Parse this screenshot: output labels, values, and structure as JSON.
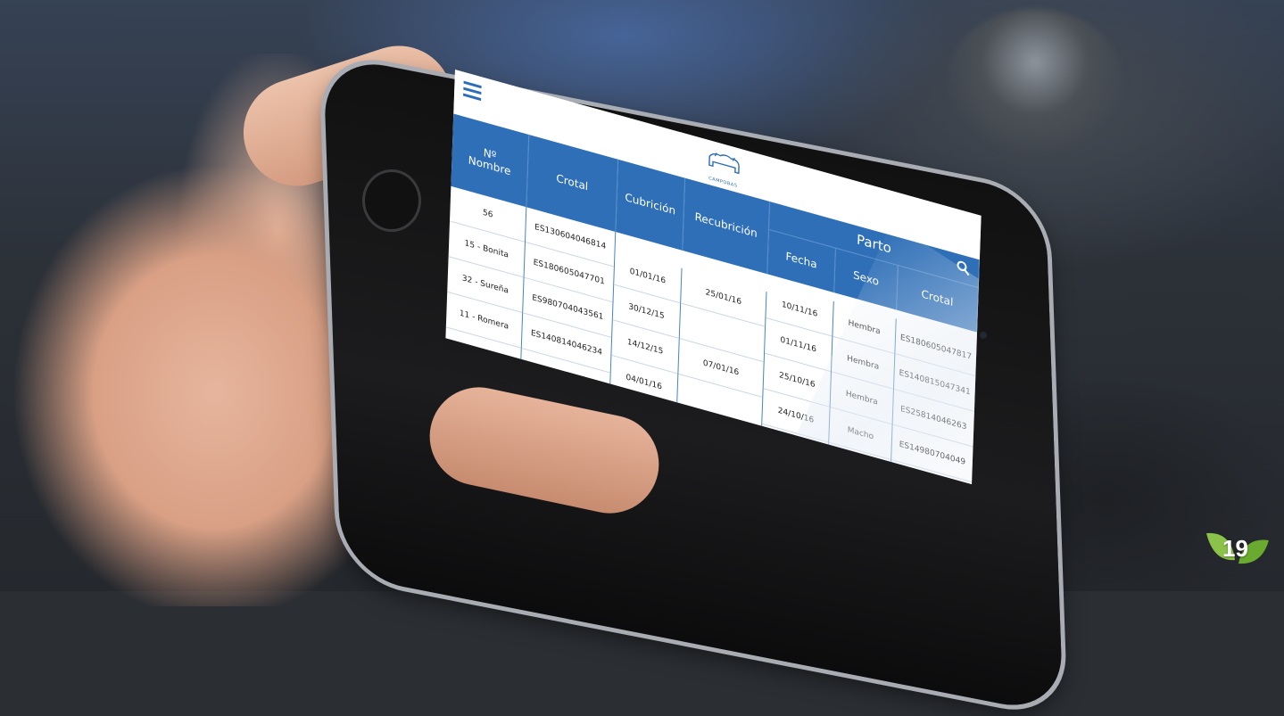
{
  "brand": {
    "logo_text": "CAMPOBAS"
  },
  "table": {
    "headers": {
      "numero_nombre_line1": "Nº",
      "numero_nombre_line2": "Nombre",
      "crotal": "Crotal",
      "cubricion": "Cubrición",
      "recubricion": "Recubrición",
      "parto": "Parto",
      "fecha": "Fecha",
      "sexo": "Sexo",
      "crotal_parto": "Crotal"
    },
    "col_nombre": [
      "56",
      "15 - Bonita",
      "32 - Sureña",
      "11 - Romera",
      ""
    ],
    "col_crotal": [
      "ES130604046814",
      "ES180605047701",
      "ES980704043561",
      "ES140814046234",
      ""
    ],
    "col_cubricion": [
      "01/01/16",
      "30/12/15",
      "14/12/15",
      "04/01/16",
      ""
    ],
    "col_recubricion": [
      "25/01/16",
      "",
      "07/01/16",
      "",
      ""
    ],
    "col_fecha": [
      "10/11/16",
      "01/11/16",
      "25/10/16",
      "24/10/16",
      ""
    ],
    "col_sexo": [
      "Hembra",
      "Hembra",
      "Hembra",
      "Macho",
      ""
    ],
    "col_crotal_parto": [
      "ES180605047817",
      "ES140815047341",
      "ES25814046263",
      "ES14980704049",
      ""
    ]
  },
  "page_number": "19",
  "colors": {
    "header_blue": "#2e6fb7",
    "badge_green": "#7cc242"
  },
  "icons": {
    "menu": "hamburger-menu-icon",
    "search": "search-icon",
    "badge": "leaf-icon"
  }
}
